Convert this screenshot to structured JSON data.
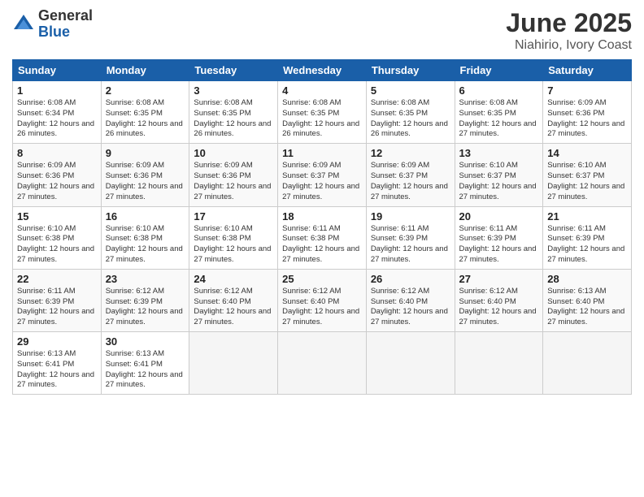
{
  "logo": {
    "general": "General",
    "blue": "Blue"
  },
  "title": "June 2025",
  "subtitle": "Niahirio, Ivory Coast",
  "weekdays": [
    "Sunday",
    "Monday",
    "Tuesday",
    "Wednesday",
    "Thursday",
    "Friday",
    "Saturday"
  ],
  "weeks": [
    [
      {
        "day": 1,
        "sunrise": "6:08 AM",
        "sunset": "6:34 PM",
        "daylight": "12 hours and 26 minutes."
      },
      {
        "day": 2,
        "sunrise": "6:08 AM",
        "sunset": "6:35 PM",
        "daylight": "12 hours and 26 minutes."
      },
      {
        "day": 3,
        "sunrise": "6:08 AM",
        "sunset": "6:35 PM",
        "daylight": "12 hours and 26 minutes."
      },
      {
        "day": 4,
        "sunrise": "6:08 AM",
        "sunset": "6:35 PM",
        "daylight": "12 hours and 26 minutes."
      },
      {
        "day": 5,
        "sunrise": "6:08 AM",
        "sunset": "6:35 PM",
        "daylight": "12 hours and 26 minutes."
      },
      {
        "day": 6,
        "sunrise": "6:08 AM",
        "sunset": "6:35 PM",
        "daylight": "12 hours and 27 minutes."
      },
      {
        "day": 7,
        "sunrise": "6:09 AM",
        "sunset": "6:36 PM",
        "daylight": "12 hours and 27 minutes."
      }
    ],
    [
      {
        "day": 8,
        "sunrise": "6:09 AM",
        "sunset": "6:36 PM",
        "daylight": "12 hours and 27 minutes."
      },
      {
        "day": 9,
        "sunrise": "6:09 AM",
        "sunset": "6:36 PM",
        "daylight": "12 hours and 27 minutes."
      },
      {
        "day": 10,
        "sunrise": "6:09 AM",
        "sunset": "6:36 PM",
        "daylight": "12 hours and 27 minutes."
      },
      {
        "day": 11,
        "sunrise": "6:09 AM",
        "sunset": "6:37 PM",
        "daylight": "12 hours and 27 minutes."
      },
      {
        "day": 12,
        "sunrise": "6:09 AM",
        "sunset": "6:37 PM",
        "daylight": "12 hours and 27 minutes."
      },
      {
        "day": 13,
        "sunrise": "6:10 AM",
        "sunset": "6:37 PM",
        "daylight": "12 hours and 27 minutes."
      },
      {
        "day": 14,
        "sunrise": "6:10 AM",
        "sunset": "6:37 PM",
        "daylight": "12 hours and 27 minutes."
      }
    ],
    [
      {
        "day": 15,
        "sunrise": "6:10 AM",
        "sunset": "6:38 PM",
        "daylight": "12 hours and 27 minutes."
      },
      {
        "day": 16,
        "sunrise": "6:10 AM",
        "sunset": "6:38 PM",
        "daylight": "12 hours and 27 minutes."
      },
      {
        "day": 17,
        "sunrise": "6:10 AM",
        "sunset": "6:38 PM",
        "daylight": "12 hours and 27 minutes."
      },
      {
        "day": 18,
        "sunrise": "6:11 AM",
        "sunset": "6:38 PM",
        "daylight": "12 hours and 27 minutes."
      },
      {
        "day": 19,
        "sunrise": "6:11 AM",
        "sunset": "6:39 PM",
        "daylight": "12 hours and 27 minutes."
      },
      {
        "day": 20,
        "sunrise": "6:11 AM",
        "sunset": "6:39 PM",
        "daylight": "12 hours and 27 minutes."
      },
      {
        "day": 21,
        "sunrise": "6:11 AM",
        "sunset": "6:39 PM",
        "daylight": "12 hours and 27 minutes."
      }
    ],
    [
      {
        "day": 22,
        "sunrise": "6:11 AM",
        "sunset": "6:39 PM",
        "daylight": "12 hours and 27 minutes."
      },
      {
        "day": 23,
        "sunrise": "6:12 AM",
        "sunset": "6:39 PM",
        "daylight": "12 hours and 27 minutes."
      },
      {
        "day": 24,
        "sunrise": "6:12 AM",
        "sunset": "6:40 PM",
        "daylight": "12 hours and 27 minutes."
      },
      {
        "day": 25,
        "sunrise": "6:12 AM",
        "sunset": "6:40 PM",
        "daylight": "12 hours and 27 minutes."
      },
      {
        "day": 26,
        "sunrise": "6:12 AM",
        "sunset": "6:40 PM",
        "daylight": "12 hours and 27 minutes."
      },
      {
        "day": 27,
        "sunrise": "6:12 AM",
        "sunset": "6:40 PM",
        "daylight": "12 hours and 27 minutes."
      },
      {
        "day": 28,
        "sunrise": "6:13 AM",
        "sunset": "6:40 PM",
        "daylight": "12 hours and 27 minutes."
      }
    ],
    [
      {
        "day": 29,
        "sunrise": "6:13 AM",
        "sunset": "6:41 PM",
        "daylight": "12 hours and 27 minutes."
      },
      {
        "day": 30,
        "sunrise": "6:13 AM",
        "sunset": "6:41 PM",
        "daylight": "12 hours and 27 minutes."
      },
      null,
      null,
      null,
      null,
      null
    ]
  ]
}
